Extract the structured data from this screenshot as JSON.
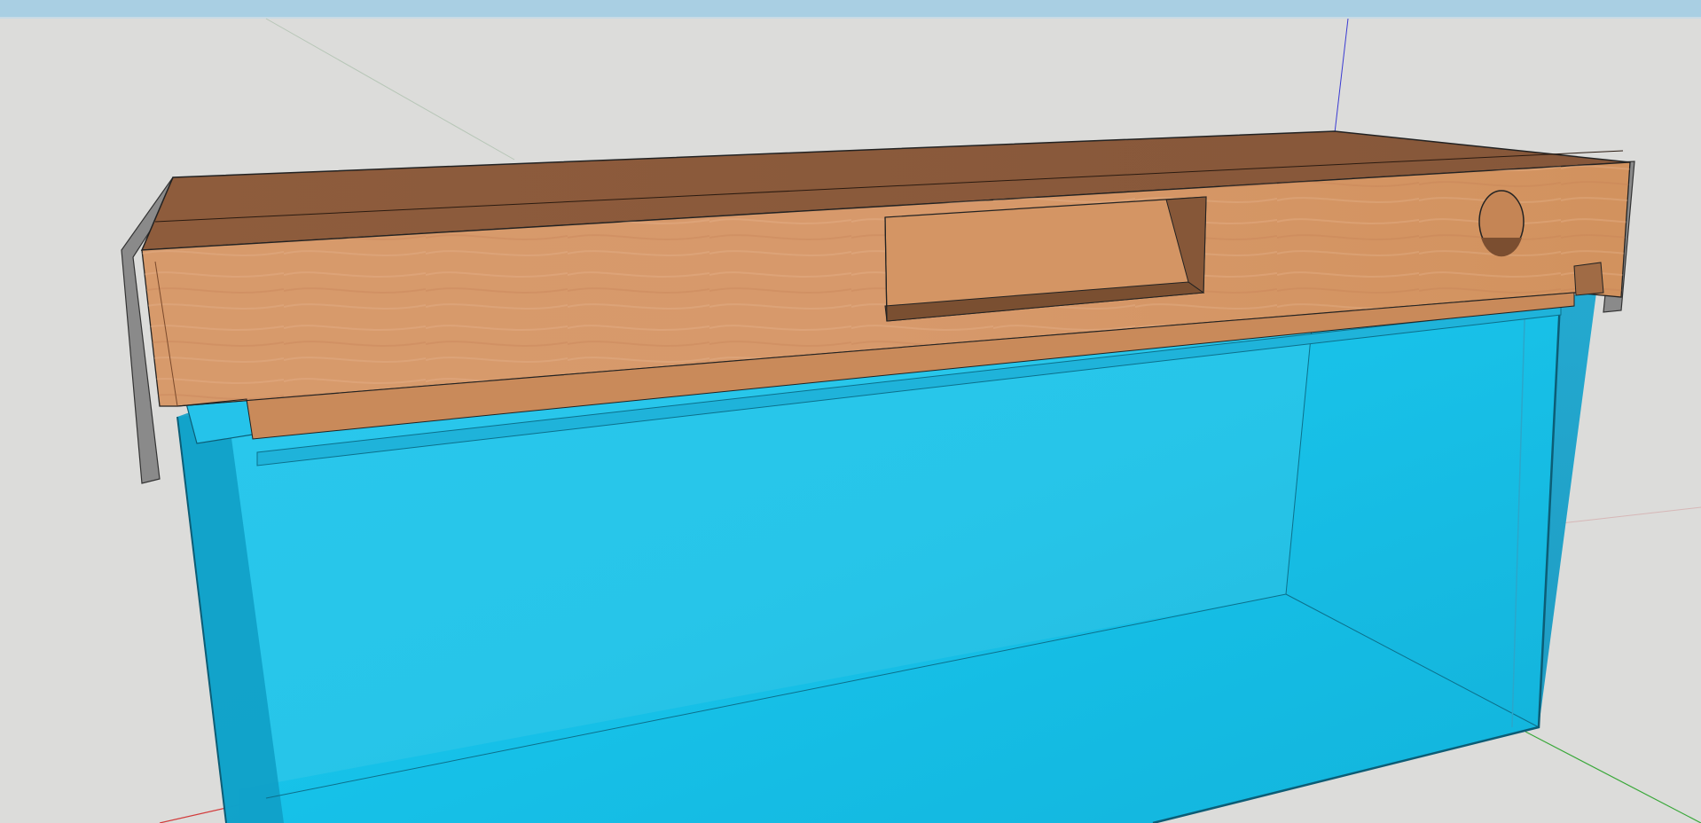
{
  "app": {
    "kind": "3d-modeling-viewport"
  },
  "viewport": {
    "background_color": "#dcdcda",
    "top_strip_color": "#a9cfe3",
    "axis_colors": {
      "red": "#d23a3a",
      "green": "#3aa83a",
      "blue": "#3a3ad2"
    }
  },
  "model": {
    "objects": [
      {
        "name": "wood-canopy",
        "material": "wood-grain",
        "color": "#cf8d5f",
        "edge_color": "#b57a4b"
      },
      {
        "name": "glass-tank",
        "material": "translucent-glass",
        "color": "#16c6ee"
      },
      {
        "name": "side-trim-left",
        "material": "gray",
        "color": "#8a8a8a"
      },
      {
        "name": "side-trim-right",
        "material": "gray",
        "color": "#8a8a8a"
      }
    ],
    "features": [
      {
        "name": "front-rectangular-opening"
      },
      {
        "name": "round-cutout"
      }
    ]
  }
}
